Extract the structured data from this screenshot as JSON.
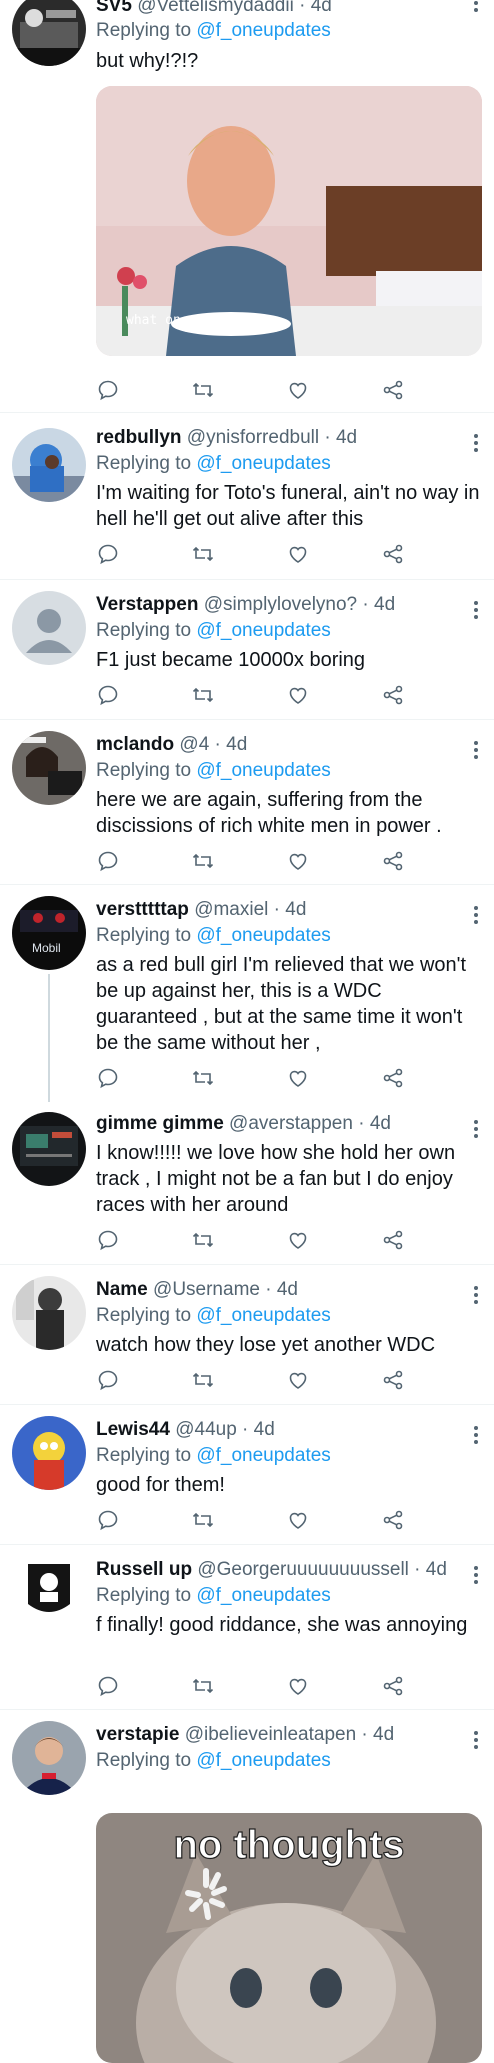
{
  "reply_prefix": "Replying to",
  "colors": {
    "link": "#1d9bf0",
    "secondary": "#536471",
    "divider": "#eff3f4"
  },
  "icons": [
    "reply-icon",
    "retweet-icon",
    "like-icon",
    "share-icon",
    "more-icon"
  ],
  "tweets": [
    {
      "name": "SV5",
      "handle": "@Vettelismydaddii",
      "time": "4d",
      "replying_to": "@f_oneupdates",
      "text": "but why!?!?",
      "media_caption": "what on earth"
    },
    {
      "name": "redbullyn",
      "handle": "@ynisforredbull",
      "time": "4d",
      "replying_to": "@f_oneupdates",
      "text": "I'm waiting for Toto's funeral, ain't no way in hell he'll get out alive after this"
    },
    {
      "name": "Verstappen",
      "handle": "@simplylovelyno?",
      "time": "4d",
      "replying_to": "@f_oneupdates",
      "text": "F1 just became 10000x boring"
    },
    {
      "name": "mclando",
      "handle": "@4",
      "time": "4d",
      "replying_to": "@f_oneupdates",
      "text": "here we are again, suffering from the discissions of rich white men in power ."
    },
    {
      "name": "verstttttap",
      "handle": "@maxiel",
      "time": "4d",
      "replying_to": "@f_oneupdates",
      "text": "as a red bull girl I'm relieved that we won't be up against her, this is a WDC guaranteed , but at the same time it won't be the same without her ,",
      "avatar_label": "Mobil"
    },
    {
      "name": "gimme gimme",
      "handle": "@averstappen",
      "time": "4d",
      "replying_to": "",
      "text": "I know!!!!! we love how she hold her own track , I might not be a fan but I do enjoy races with her around"
    },
    {
      "name": "Name",
      "handle": "@Username",
      "time": "4d",
      "replying_to": "@f_oneupdates",
      "text": "watch how they lose yet another WDC"
    },
    {
      "name": "Lewis44",
      "handle": "@44up",
      "time": "4d",
      "replying_to": "@f_oneupdates",
      "text": "good for them!"
    },
    {
      "name": "Russell up",
      "handle": "@Georgeruuuuuuuussell",
      "time": "4d",
      "replying_to": "@f_oneupdates",
      "text": "f finally! good riddance, she was annoying"
    },
    {
      "name": "verstapie",
      "handle": "@ibelieveinleatapen",
      "time": "4d",
      "replying_to": "@f_oneupdates",
      "text": "",
      "media_caption": "no thoughts"
    }
  ]
}
